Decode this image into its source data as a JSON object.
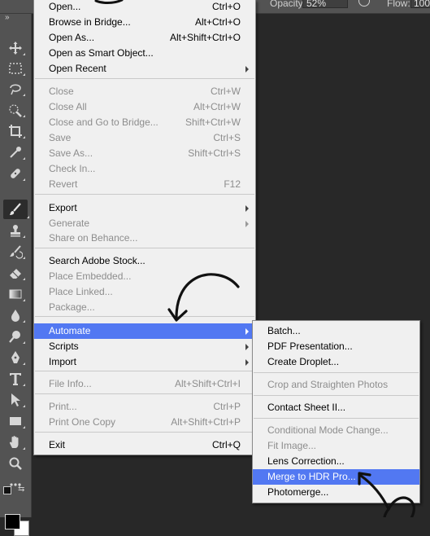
{
  "options_bar": {
    "opacity_label": "Opacity:",
    "opacity_value": "52%",
    "flow_label": "Flow:",
    "flow_value": "100"
  },
  "colors": {
    "highlight": "#5278f2",
    "menu_bg": "#f0f0f0",
    "disabled_text": "#8d8d8d",
    "toolbar_bg": "#535353",
    "canvas_bg": "#282828"
  },
  "tools": [
    "move-tool-icon",
    "marquee-tool-icon",
    "lasso-tool-icon",
    "quick-selection-tool-icon",
    "crop-tool-icon",
    "eyedropper-tool-icon",
    "healing-brush-tool-icon",
    "brush-tool-icon",
    "clone-stamp-tool-icon",
    "history-brush-tool-icon",
    "eraser-tool-icon",
    "gradient-tool-icon",
    "blur-tool-icon",
    "dodge-tool-icon",
    "pen-tool-icon",
    "type-tool-icon",
    "path-selection-tool-icon",
    "rectangle-tool-icon",
    "hand-tool-icon",
    "zoom-tool-icon",
    "more-tools-icon"
  ],
  "file_menu": {
    "items": [
      {
        "label": "Open...",
        "shortcut": "Ctrl+O",
        "enabled": true
      },
      {
        "label": "Browse in Bridge...",
        "shortcut": "Alt+Ctrl+O",
        "enabled": true
      },
      {
        "label": "Open As...",
        "shortcut": "Alt+Shift+Ctrl+O",
        "enabled": true
      },
      {
        "label": "Open as Smart Object...",
        "shortcut": "",
        "enabled": true
      },
      {
        "label": "Open Recent",
        "shortcut": "",
        "enabled": true,
        "submenu": true
      },
      {
        "label": "Close",
        "shortcut": "Ctrl+W",
        "enabled": false
      },
      {
        "label": "Close All",
        "shortcut": "Alt+Ctrl+W",
        "enabled": false
      },
      {
        "label": "Close and Go to Bridge...",
        "shortcut": "Shift+Ctrl+W",
        "enabled": false
      },
      {
        "label": "Save",
        "shortcut": "Ctrl+S",
        "enabled": false
      },
      {
        "label": "Save As...",
        "shortcut": "Shift+Ctrl+S",
        "enabled": false
      },
      {
        "label": "Check In...",
        "shortcut": "",
        "enabled": false
      },
      {
        "label": "Revert",
        "shortcut": "F12",
        "enabled": false
      },
      {
        "label": "Export",
        "shortcut": "",
        "enabled": true,
        "submenu": true
      },
      {
        "label": "Generate",
        "shortcut": "",
        "enabled": false,
        "submenu": true
      },
      {
        "label": "Share on Behance...",
        "shortcut": "",
        "enabled": false
      },
      {
        "label": "Search Adobe Stock...",
        "shortcut": "",
        "enabled": true
      },
      {
        "label": "Place Embedded...",
        "shortcut": "",
        "enabled": false
      },
      {
        "label": "Place Linked...",
        "shortcut": "",
        "enabled": false
      },
      {
        "label": "Package...",
        "shortcut": "",
        "enabled": false
      },
      {
        "label": "Automate",
        "shortcut": "",
        "enabled": true,
        "submenu": true,
        "highlighted": true
      },
      {
        "label": "Scripts",
        "shortcut": "",
        "enabled": true,
        "submenu": true
      },
      {
        "label": "Import",
        "shortcut": "",
        "enabled": true,
        "submenu": true
      },
      {
        "label": "File Info...",
        "shortcut": "Alt+Shift+Ctrl+I",
        "enabled": false
      },
      {
        "label": "Print...",
        "shortcut": "Ctrl+P",
        "enabled": false
      },
      {
        "label": "Print One Copy",
        "shortcut": "Alt+Shift+Ctrl+P",
        "enabled": false
      },
      {
        "label": "Exit",
        "shortcut": "Ctrl+Q",
        "enabled": true
      }
    ]
  },
  "automate_submenu": {
    "items": [
      {
        "label": "Batch...",
        "enabled": true
      },
      {
        "label": "PDF Presentation...",
        "enabled": true
      },
      {
        "label": "Create Droplet...",
        "enabled": true
      },
      {
        "label": "Crop and Straighten Photos",
        "enabled": false
      },
      {
        "label": "Contact Sheet II...",
        "enabled": true
      },
      {
        "label": "Conditional Mode Change...",
        "enabled": false
      },
      {
        "label": "Fit Image...",
        "enabled": false
      },
      {
        "label": "Lens Correction...",
        "enabled": true
      },
      {
        "label": "Merge to HDR Pro...",
        "enabled": true,
        "highlighted": true
      },
      {
        "label": "Photomerge...",
        "enabled": true
      }
    ]
  }
}
